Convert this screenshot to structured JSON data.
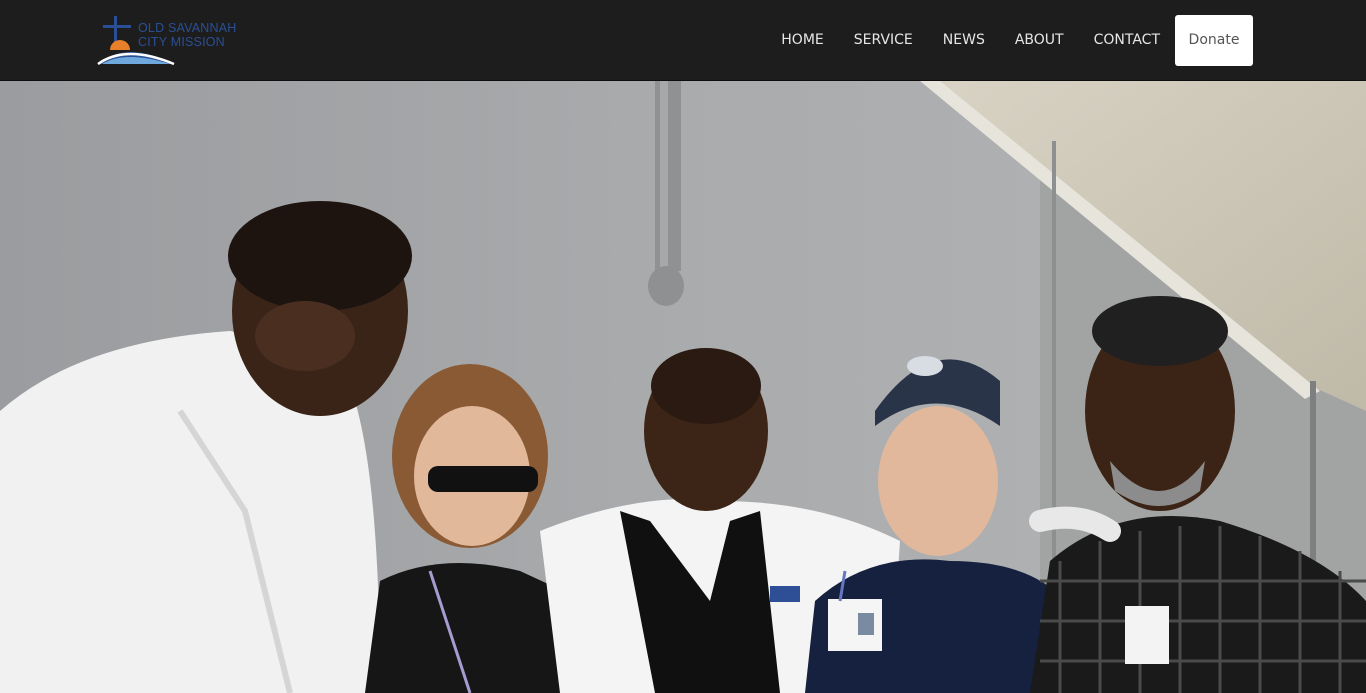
{
  "brand": {
    "line1": "OLD SAVANNAH",
    "line2": "CITY MISSION"
  },
  "nav": {
    "items": [
      {
        "label": "HOME"
      },
      {
        "label": "SERVICE"
      },
      {
        "label": "NEWS"
      },
      {
        "label": "ABOUT"
      },
      {
        "label": "CONTACT"
      }
    ],
    "donate_label": "Donate"
  },
  "colors": {
    "navbar": "#1d1d1d",
    "brand_blue": "#2b4f95",
    "sun_orange": "#e8802a",
    "wall": "#a4a6a8"
  }
}
